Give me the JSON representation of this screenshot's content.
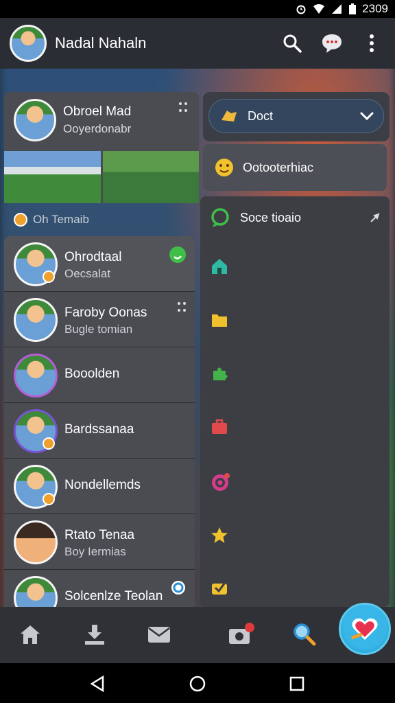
{
  "status_bar": {
    "time": "2309"
  },
  "app_bar": {
    "title": "Nadal Nahaln",
    "icons": [
      "search-icon",
      "chat-bubble-icon",
      "more-vert-icon"
    ]
  },
  "profile": {
    "name": "Obroel Mad",
    "subtitle": "Ooyerdonabr",
    "section_label": "Oh Temaib"
  },
  "chats": [
    {
      "name": "Ohrodtaal",
      "message": "Oecsalat",
      "icon": "whatsapp-icon"
    },
    {
      "name": "Faroby Oonas",
      "message": "Bugle tomian",
      "icon": "dots-icon"
    },
    {
      "name": "Booolden",
      "message": ""
    },
    {
      "name": "Bardssanaa",
      "message": ""
    },
    {
      "name": "Nondellemds",
      "message": ""
    },
    {
      "name": "Rtato Tenaa",
      "message": "Boy Iermias"
    },
    {
      "name": "Solcenlze Teolan",
      "message": "",
      "icon": "ring-icon"
    }
  ],
  "right_panel": {
    "dropdown_label": "Doct",
    "status_label": "Ootooterhiac",
    "menu_first_label": "Soce tioaio",
    "menu_icons": [
      "chat-circle-icon",
      "house-icon",
      "folder-icon",
      "puzzle-icon",
      "briefcase-icon",
      "target-icon",
      "star-icon",
      "check-icon"
    ]
  },
  "bottom_nav": {
    "items": [
      "home-icon",
      "download-icon",
      "mail-icon",
      "camera-icon",
      "search-icon"
    ],
    "camera_badge": "0"
  },
  "colors": {
    "appbar": "#2a2d33",
    "panel": "#4a4c52",
    "accent_blue": "#38b6e8",
    "orange": "#f0a02c",
    "green": "#3fbf4a"
  }
}
